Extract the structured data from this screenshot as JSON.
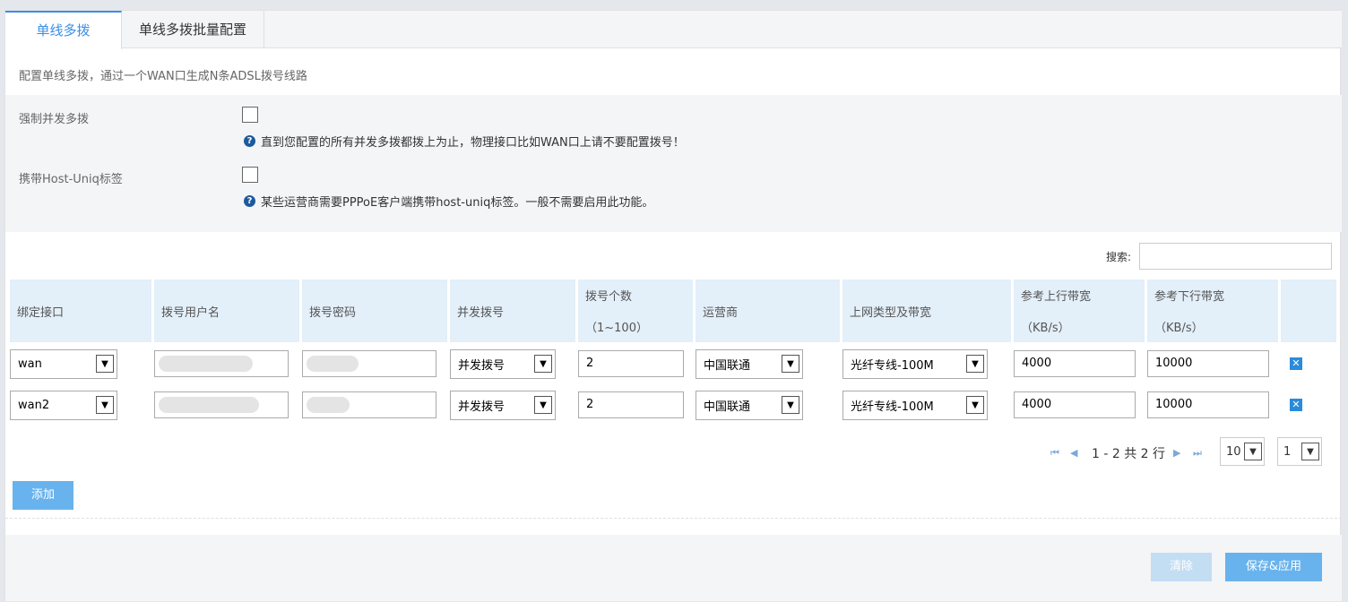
{
  "tabs": [
    {
      "label": "单线多拨",
      "active": true
    },
    {
      "label": "单线多拨批量配置",
      "active": false
    }
  ],
  "description": "配置单线多拨，通过一个WAN口生成N条ADSL拨号线路",
  "options": [
    {
      "label": "强制并发多拨",
      "checked": false,
      "hint": "直到您配置的所有并发多拨都拨上为止，物理接口比如WAN口上请不要配置拨号！"
    },
    {
      "label": "携带Host-Uniq标签",
      "checked": false,
      "hint": "某些运营商需要PPPoE客户端携带host-uniq标签。一般不需要启用此功能。"
    }
  ],
  "search": {
    "label": "搜索:",
    "value": ""
  },
  "table": {
    "headers": [
      {
        "line1": "绑定接口",
        "line2": ""
      },
      {
        "line1": "拨号用户名",
        "line2": ""
      },
      {
        "line1": "拨号密码",
        "line2": ""
      },
      {
        "line1": "并发拨号",
        "line2": ""
      },
      {
        "line1": "拨号个数",
        "line2": "（1~100）"
      },
      {
        "line1": "运营商",
        "line2": ""
      },
      {
        "line1": "上网类型及带宽",
        "line2": ""
      },
      {
        "line1": "参考上行带宽",
        "line2": "（KB/s）"
      },
      {
        "line1": "参考下行带宽",
        "line2": "（KB/s）"
      },
      {
        "line1": "",
        "line2": ""
      }
    ],
    "rows": [
      {
        "interface": "wan",
        "mode": "并发拨号",
        "count": "2",
        "isp": "中国联通",
        "type": "光纤专线-100M",
        "up": "4000",
        "down": "10000"
      },
      {
        "interface": "wan2",
        "mode": "并发拨号",
        "count": "2",
        "isp": "中国联通",
        "type": "光纤专线-100M",
        "up": "4000",
        "down": "10000"
      }
    ]
  },
  "pagination": {
    "summary": "1 - 2 共 2 行",
    "page_size": "10",
    "page": "1"
  },
  "buttons": {
    "add": "添加",
    "clear": "清除",
    "save": "保存&应用"
  },
  "colors": {
    "accent": "#3a8ee6",
    "button": "#68b3ee",
    "button_disabled": "#c3ddf3",
    "header_bg": "#e3eff9"
  }
}
